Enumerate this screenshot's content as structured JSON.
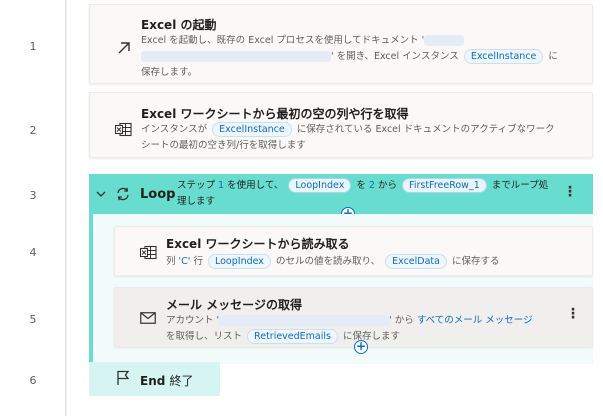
{
  "lines": [
    "1",
    "2",
    "3",
    "4",
    "5",
    "6"
  ],
  "steps": {
    "s1": {
      "title": "Excel の起動",
      "desc_a": "Excel を起動し、既存の Excel プロセスを使用してドキュメント '",
      "desc_b": "' を開き、Excel インスタンス",
      "var": "ExcelInstance",
      "desc_c": "に",
      "desc_d": "保存します。",
      "icon": "external-link-arrow-icon"
    },
    "s2": {
      "title": "Excel ワークシートから最初の空の列や行を取得",
      "desc_a": "インスタンスが",
      "var": "ExcelInstance",
      "desc_b": "に保存されている Excel ドキュメントのアクティブなワーク",
      "desc_c": "シートの最初の空き列/行を取得します",
      "icon": "excel-grid-icon"
    },
    "loop": {
      "label": "Loop",
      "desc_a": "ステップ",
      "step": "1",
      "desc_b": "を使用して、",
      "var1": "LoopIndex",
      "desc_c": "を",
      "to": "2",
      "desc_d": "から",
      "var2": "FirstFreeRow_1",
      "desc_e": "までループ処",
      "desc_f": "理します",
      "icon": "loop-arrows-icon"
    },
    "s4": {
      "title": "Excel ワークシートから読み取る",
      "desc_a": "列",
      "col": "'C'",
      "desc_b": "行",
      "var1": "LoopIndex",
      "desc_c": "のセルの値を読み取り、",
      "var2": "ExcelData",
      "desc_d": "に保存する",
      "icon": "excel-grid-icon"
    },
    "s5": {
      "title": "メール メッセージの取得",
      "desc_a": "アカウント '",
      "desc_b": "' から",
      "link": "すべてのメール メッセージ",
      "desc_c": "を取得し、リスト",
      "var": "RetrievedEmails",
      "desc_d": "に保存します",
      "icon": "envelope-icon"
    },
    "end": {
      "label": "End",
      "suffix": "終了",
      "icon": "flag-icon"
    }
  },
  "colors": {
    "loop_accent": "#67dccf",
    "tag_text": "#0f6cbd"
  }
}
